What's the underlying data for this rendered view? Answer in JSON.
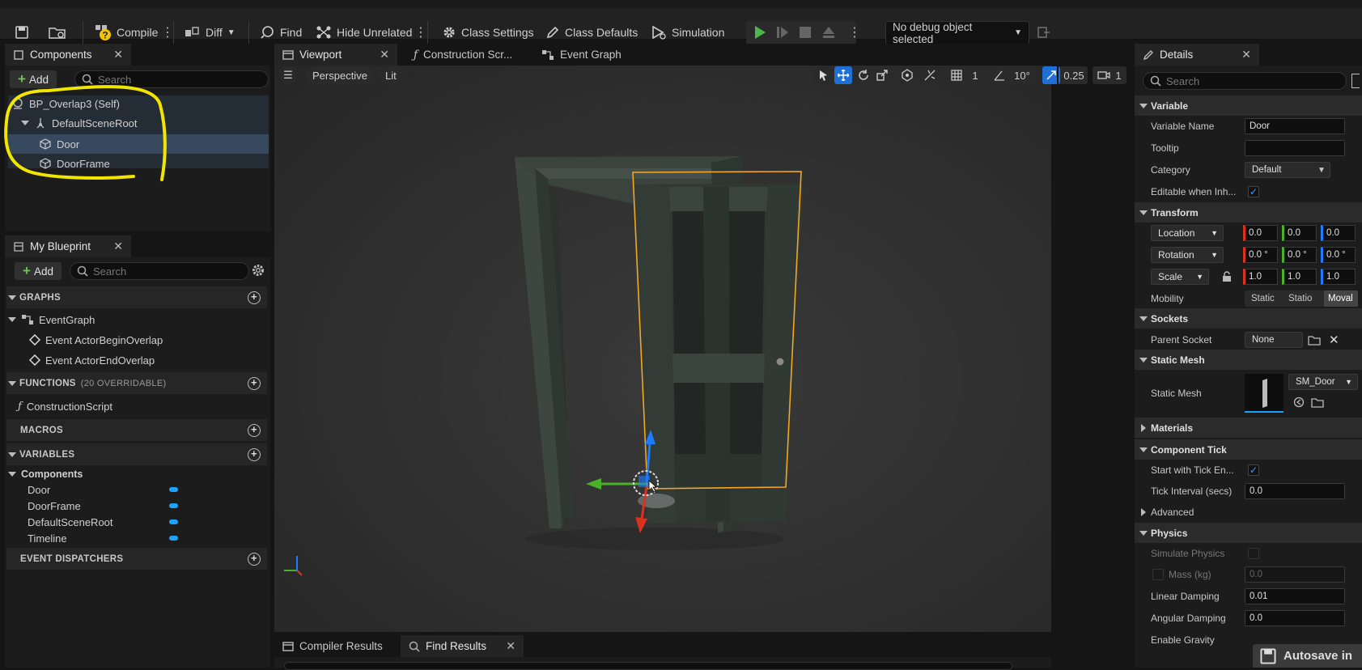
{
  "toolbar": {
    "compile": "Compile",
    "diff": "Diff",
    "find": "Find",
    "hide_unrelated": "Hide Unrelated",
    "class_settings": "Class Settings",
    "class_defaults": "Class Defaults",
    "simulation": "Simulation",
    "debug_selector": "No debug object selected"
  },
  "components_panel": {
    "tab": "Components",
    "add": "Add",
    "search_placeholder": "Search",
    "tree": [
      {
        "label": "BP_Overlap3 (Self)",
        "icon": "actor-icon"
      },
      {
        "label": "DefaultSceneRoot",
        "icon": "scene-root-icon"
      },
      {
        "label": "Door",
        "icon": "static-mesh-icon",
        "selected": true
      },
      {
        "label": "DoorFrame",
        "icon": "static-mesh-icon"
      }
    ],
    "highlight_color": "#f2e600"
  },
  "blueprint_panel": {
    "tab": "My Blueprint",
    "add": "Add",
    "search_placeholder": "Search",
    "graphs": "GRAPHS",
    "event_graph": "EventGraph",
    "events": [
      "Event ActorBeginOverlap",
      "Event ActorEndOverlap"
    ],
    "functions": "FUNCTIONS",
    "functions_note": "(20 OVERRIDABLE)",
    "construction_script": "ConstructionScript",
    "macros": "MACROS",
    "variables": "VARIABLES",
    "components_group": "Components",
    "component_vars": [
      "Door",
      "DoorFrame",
      "DefaultSceneRoot",
      "Timeline"
    ],
    "event_dispatchers": "EVENT DISPATCHERS"
  },
  "editor_tabs": {
    "viewport": "Viewport",
    "construction": "Construction Scr...",
    "event_graph": "Event Graph"
  },
  "viewport": {
    "perspective": "Perspective",
    "lit": "Lit",
    "grid_size": "1",
    "angle": "10°",
    "scale": "0.25",
    "camera_speed": "1",
    "selection_color": "#f5a623"
  },
  "bottom_tabs": {
    "compiler": "Compiler Results",
    "find": "Find Results"
  },
  "details": {
    "tab": "Details",
    "search_placeholder": "Search",
    "variable": "Variable",
    "variable_name_label": "Variable Name",
    "variable_name": "Door",
    "tooltip_label": "Tooltip",
    "category_label": "Category",
    "category": "Default",
    "editable_label": "Editable when Inh...",
    "transform": "Transform",
    "location": "Location",
    "rotation": "Rotation",
    "scale": "Scale",
    "loc": [
      "0.0",
      "0.0",
      "0.0"
    ],
    "rot": [
      "0.0 °",
      "0.0 °",
      "0.0 °"
    ],
    "scl": [
      "1.0",
      "1.0",
      "1.0"
    ],
    "mobility_label": "Mobility",
    "mobility": [
      "Static",
      "Statio",
      "Moval"
    ],
    "sockets": "Sockets",
    "parent_socket_label": "Parent Socket",
    "parent_socket": "None",
    "static_mesh_head": "Static Mesh",
    "static_mesh_label": "Static Mesh",
    "static_mesh": "SM_Door",
    "materials": "Materials",
    "component_tick": "Component Tick",
    "start_tick_label": "Start with Tick En...",
    "tick_interval_label": "Tick Interval (secs)",
    "tick_interval": "0.0",
    "advanced": "Advanced",
    "physics": "Physics",
    "simulate_label": "Simulate Physics",
    "mass_label": "Mass (kg)",
    "mass": "0.0",
    "linear_label": "Linear Damping",
    "linear": "0.01",
    "angular_label": "Angular Damping",
    "angular": "0.0",
    "gravity_label": "Enable Gravity"
  },
  "autosave": "Autosave in"
}
